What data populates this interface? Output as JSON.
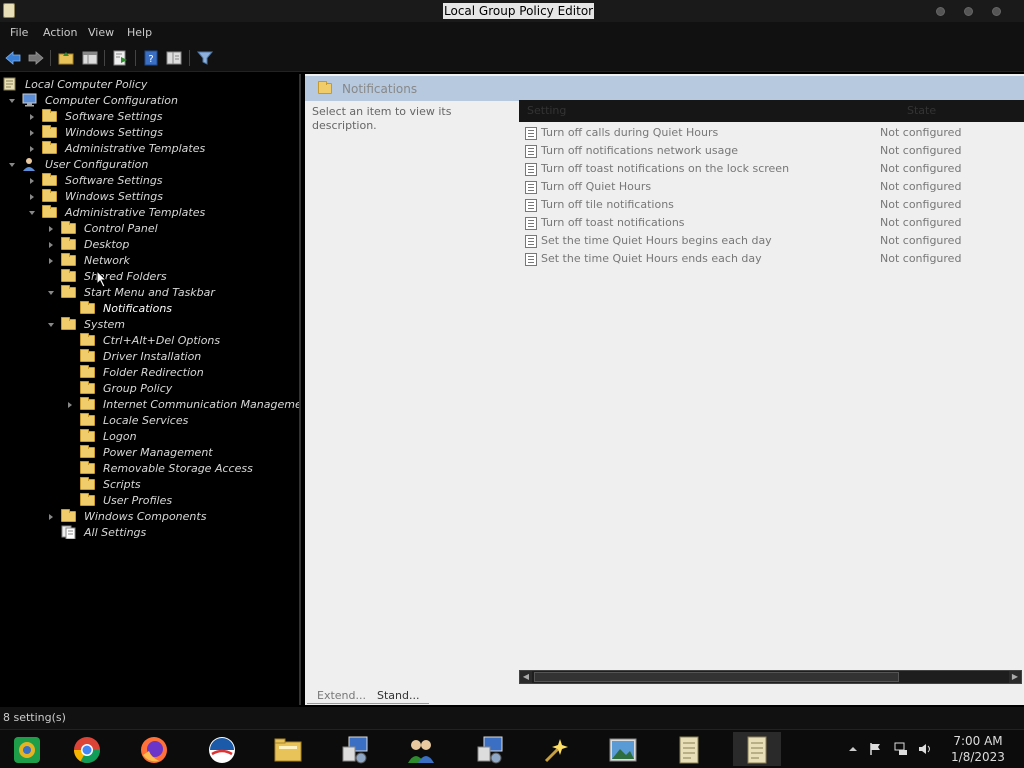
{
  "window": {
    "title": "Local Group Policy Editor",
    "accent": "#b7c9df"
  },
  "menu": [
    "File",
    "Action",
    "View",
    "Help"
  ],
  "toolbar": {
    "icons": [
      "back-arrow-icon",
      "forward-arrow-icon",
      "up-folder-icon",
      "show-hide-tree-icon",
      "export-list-icon",
      "help-icon",
      "properties-icon",
      "filter-icon"
    ]
  },
  "tree": {
    "nodes": [
      {
        "label": "Local Computer Policy",
        "icon": "policy-scroll-icon"
      },
      {
        "label": "Computer Configuration",
        "icon": "computer-icon",
        "expanded": true
      },
      {
        "label": "Software Settings",
        "icon": "folder-icon"
      },
      {
        "label": "Windows Settings",
        "icon": "folder-icon"
      },
      {
        "label": "Administrative Templates",
        "icon": "folder-icon"
      },
      {
        "label": "User Configuration",
        "icon": "user-icon",
        "expanded": true
      },
      {
        "label": "Software Settings",
        "icon": "folder-icon"
      },
      {
        "label": "Windows Settings",
        "icon": "folder-icon"
      },
      {
        "label": "Administrative Templates",
        "icon": "folder-icon",
        "expanded": true
      },
      {
        "label": "Control Panel",
        "icon": "folder-icon"
      },
      {
        "label": "Desktop",
        "icon": "folder-icon"
      },
      {
        "label": "Network",
        "icon": "folder-icon"
      },
      {
        "label": "Shared Folders",
        "icon": "folder-icon"
      },
      {
        "label": "Start Menu and Taskbar",
        "icon": "folder-icon",
        "expanded": true
      },
      {
        "label": "Notifications",
        "icon": "folder-icon",
        "selected": true
      },
      {
        "label": "System",
        "icon": "folder-icon",
        "expanded": true
      },
      {
        "label": "Ctrl+Alt+Del Options",
        "icon": "folder-icon"
      },
      {
        "label": "Driver Installation",
        "icon": "folder-icon"
      },
      {
        "label": "Folder Redirection",
        "icon": "folder-icon"
      },
      {
        "label": "Group Policy",
        "icon": "folder-icon"
      },
      {
        "label": "Internet Communication Management",
        "icon": "folder-icon"
      },
      {
        "label": "Locale Services",
        "icon": "folder-icon"
      },
      {
        "label": "Logon",
        "icon": "folder-icon"
      },
      {
        "label": "Power Management",
        "icon": "folder-icon"
      },
      {
        "label": "Removable Storage Access",
        "icon": "folder-icon"
      },
      {
        "label": "Scripts",
        "icon": "folder-icon"
      },
      {
        "label": "User Profiles",
        "icon": "folder-icon"
      },
      {
        "label": "Windows Components",
        "icon": "folder-icon"
      },
      {
        "label": "All Settings",
        "icon": "all-settings-icon"
      }
    ]
  },
  "content": {
    "header_title": "Notifications",
    "description": "Select an item to view its description.",
    "columns": {
      "setting": "Setting",
      "state": "State"
    },
    "rows": [
      {
        "name": "Turn off calls during Quiet Hours",
        "state": "Not configured"
      },
      {
        "name": "Turn off notifications network usage",
        "state": "Not configured"
      },
      {
        "name": "Turn off toast notifications on the lock screen",
        "state": "Not configured"
      },
      {
        "name": "Turn off Quiet Hours",
        "state": "Not configured"
      },
      {
        "name": "Turn off tile notifications",
        "state": "Not configured"
      },
      {
        "name": "Turn off toast notifications",
        "state": "Not configured"
      },
      {
        "name": "Set the time Quiet Hours begins each day",
        "state": "Not configured"
      },
      {
        "name": "Set the time Quiet Hours ends each day",
        "state": "Not configured"
      }
    ],
    "tabs": [
      "Extend...",
      "Stand..."
    ]
  },
  "status": {
    "text": "8 setting(s)"
  },
  "taskbar": {
    "apps": [
      "app-launcher-icon",
      "chrome-icon",
      "firefox-icon",
      "media-app-icon",
      "file-manager-icon",
      "network-tool-icon",
      "users-app-icon",
      "network-tool-icon",
      "magic-wand-icon",
      "image-viewer-icon",
      "policy-scroll-icon",
      "policy-scroll-icon"
    ],
    "tray": [
      "chevron-up-icon",
      "flag-icon",
      "network-icon",
      "volume-icon"
    ],
    "time": "7:00 AM",
    "date": "1/8/2023"
  }
}
